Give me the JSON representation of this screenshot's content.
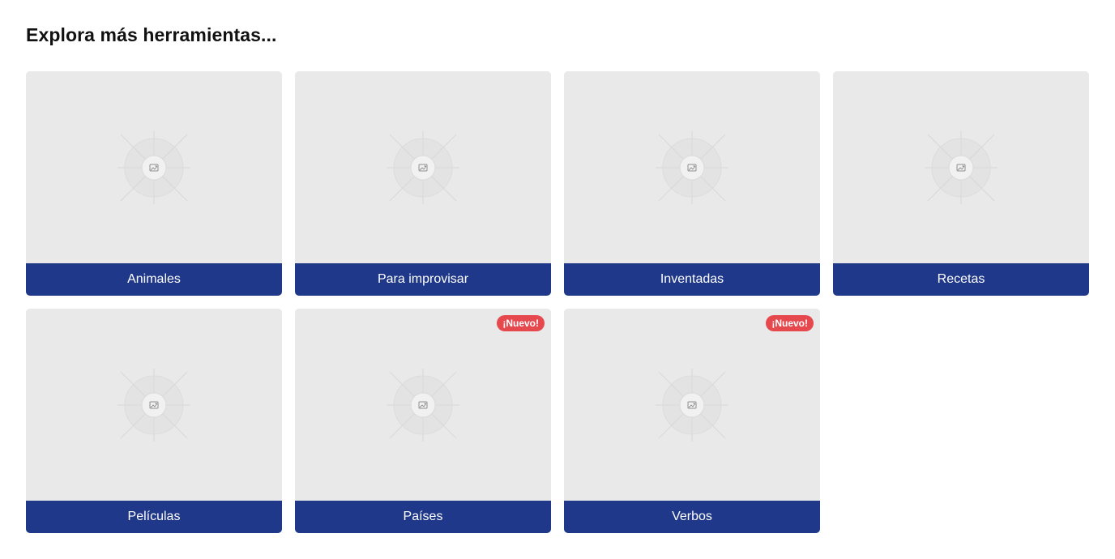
{
  "section": {
    "title": "Explora más herramientas..."
  },
  "cards": [
    {
      "label": "Animales",
      "badge": "",
      "icon": "image-placeholder-icon"
    },
    {
      "label": "Para improvisar",
      "badge": "",
      "icon": "image-placeholder-icon"
    },
    {
      "label": "Inventadas",
      "badge": "",
      "icon": "image-placeholder-icon"
    },
    {
      "label": "Recetas",
      "badge": "",
      "icon": "image-placeholder-icon"
    },
    {
      "label": "Películas",
      "badge": "",
      "icon": "image-placeholder-icon"
    },
    {
      "label": "Países",
      "badge": "¡Nuevo!",
      "icon": "image-placeholder-icon"
    },
    {
      "label": "Verbos",
      "badge": "¡Nuevo!",
      "icon": "image-placeholder-icon"
    }
  ],
  "colors": {
    "label_bg": "#1f3889",
    "badge_bg": "#e5484d",
    "thumb_bg": "#e9e9e9"
  }
}
